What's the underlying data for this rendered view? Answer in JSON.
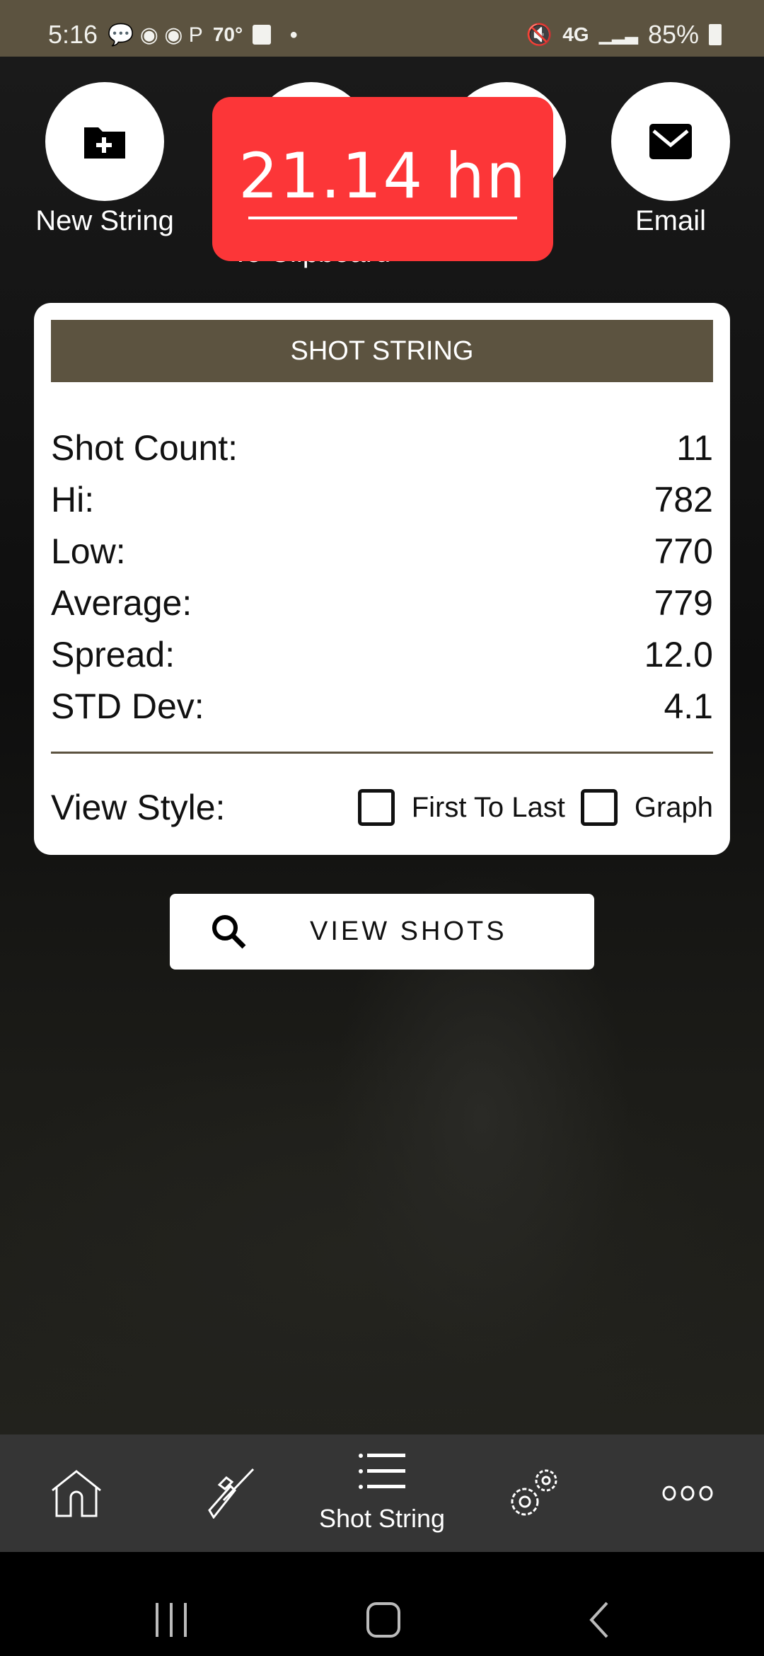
{
  "status_bar": {
    "time": "5:16",
    "temp": "70°",
    "network": "4G",
    "battery": "85%"
  },
  "actions": [
    {
      "label": "New String",
      "icon": "folder-plus-icon"
    },
    {
      "label": "",
      "icon": "unknown"
    },
    {
      "label": "",
      "icon": "unknown"
    },
    {
      "label": "Email",
      "icon": "email-icon"
    }
  ],
  "clipboard_label": "To Clipboard",
  "toast": {
    "text": "21.14 hn",
    "color": "#fc3638"
  },
  "card": {
    "title": "SHOT STRING",
    "stats": [
      {
        "label": "Shot Count:",
        "value": "11"
      },
      {
        "label": "Hi:",
        "value": "782"
      },
      {
        "label": "Low:",
        "value": "770"
      },
      {
        "label": "Average:",
        "value": "779"
      },
      {
        "label": "Spread:",
        "value": "12.0"
      },
      {
        "label": "STD Dev:",
        "value": "4.1"
      }
    ],
    "view_style_label": "View Style:",
    "options": [
      {
        "label": "First To Last",
        "checked": false
      },
      {
        "label": "Graph",
        "checked": false
      }
    ]
  },
  "view_shots_label": "VIEW SHOTS",
  "bottom_nav": {
    "active_label": "Shot String",
    "items": [
      "home",
      "rifle",
      "shot-string",
      "settings",
      "more"
    ]
  },
  "colors": {
    "brand": "#5c5340",
    "nav": "#353535"
  }
}
